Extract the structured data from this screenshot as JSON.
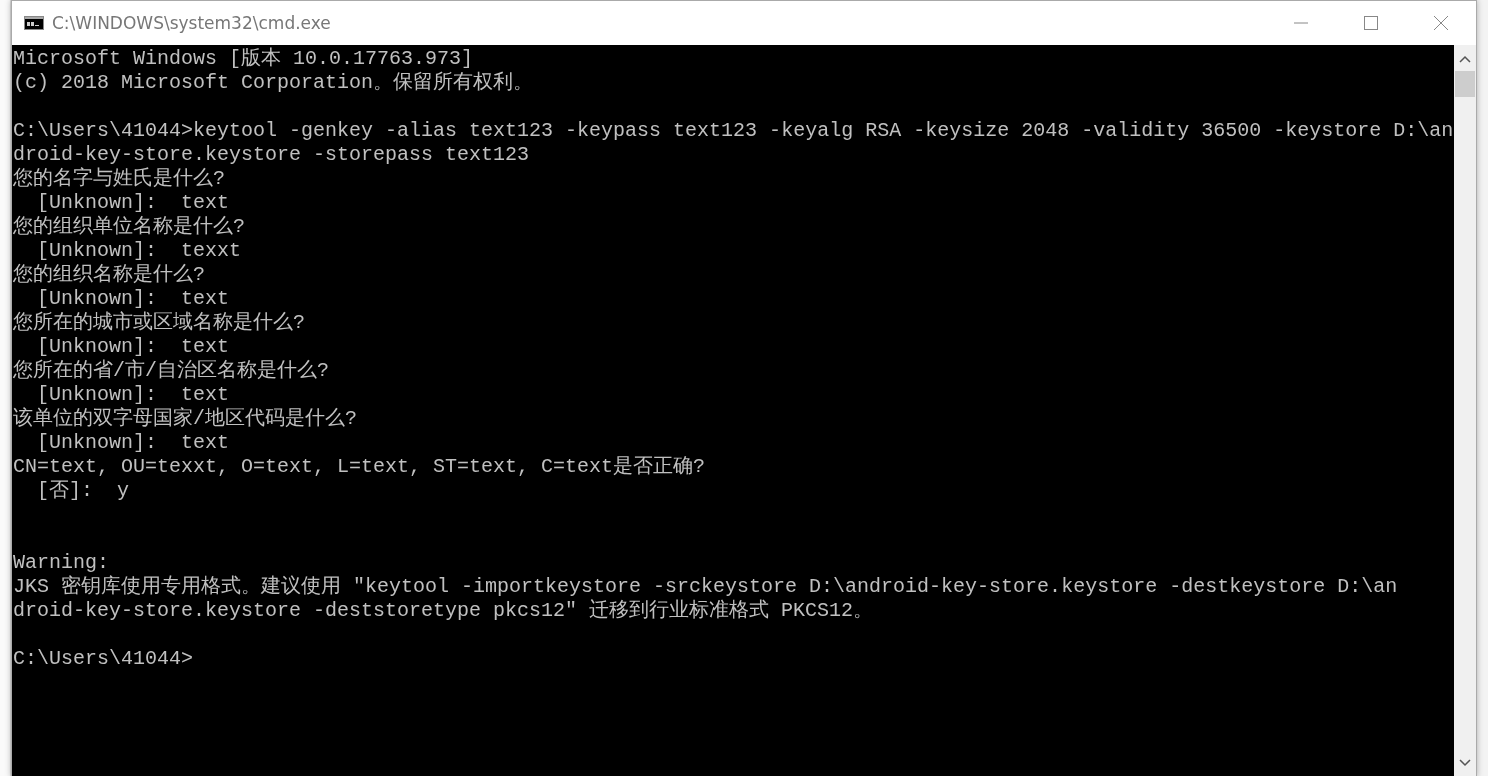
{
  "window": {
    "title": "C:\\WINDOWS\\system32\\cmd.exe"
  },
  "console": {
    "lines": [
      {
        "kind": "text",
        "text": "Microsoft Windows [版本 10.0.17763.973]"
      },
      {
        "kind": "text",
        "text": "(c) 2018 Microsoft Corporation。保留所有权利。"
      },
      {
        "kind": "blank"
      },
      {
        "kind": "text",
        "text": "C:\\Users\\41044>keytool -genkey -alias text123 -keypass text123 -keyalg RSA -keysize 2048 -validity 36500 -keystore D:\\an"
      },
      {
        "kind": "text",
        "text": "droid-key-store.keystore -storepass text123"
      },
      {
        "kind": "text",
        "text": "您的名字与姓氏是什么?"
      },
      {
        "kind": "text",
        "text": "  [Unknown]:  text"
      },
      {
        "kind": "text",
        "text": "您的组织单位名称是什么?"
      },
      {
        "kind": "text",
        "text": "  [Unknown]:  texxt"
      },
      {
        "kind": "text",
        "text": "您的组织名称是什么?"
      },
      {
        "kind": "text",
        "text": "  [Unknown]:  text"
      },
      {
        "kind": "text",
        "text": "您所在的城市或区域名称是什么?"
      },
      {
        "kind": "text",
        "text": "  [Unknown]:  text"
      },
      {
        "kind": "text",
        "text": "您所在的省/市/自治区名称是什么?"
      },
      {
        "kind": "text",
        "text": "  [Unknown]:  text"
      },
      {
        "kind": "text",
        "text": "该单位的双字母国家/地区代码是什么?"
      },
      {
        "kind": "text",
        "text": "  [Unknown]:  text"
      },
      {
        "kind": "text",
        "text": "CN=text, OU=texxt, O=text, L=text, ST=text, C=text是否正确?"
      },
      {
        "kind": "text",
        "text": "  [否]:  y"
      },
      {
        "kind": "blank"
      },
      {
        "kind": "blank"
      },
      {
        "kind": "text",
        "text": "Warning:"
      },
      {
        "kind": "text",
        "text": "JKS 密钥库使用专用格式。建议使用 \"keytool -importkeystore -srckeystore D:\\android-key-store.keystore -destkeystore D:\\an"
      },
      {
        "kind": "text",
        "text": "droid-key-store.keystore -deststoretype pkcs12\" 迁移到行业标准格式 PKCS12。"
      },
      {
        "kind": "blank"
      },
      {
        "kind": "text",
        "text": "C:\\Users\\41044>"
      }
    ]
  }
}
